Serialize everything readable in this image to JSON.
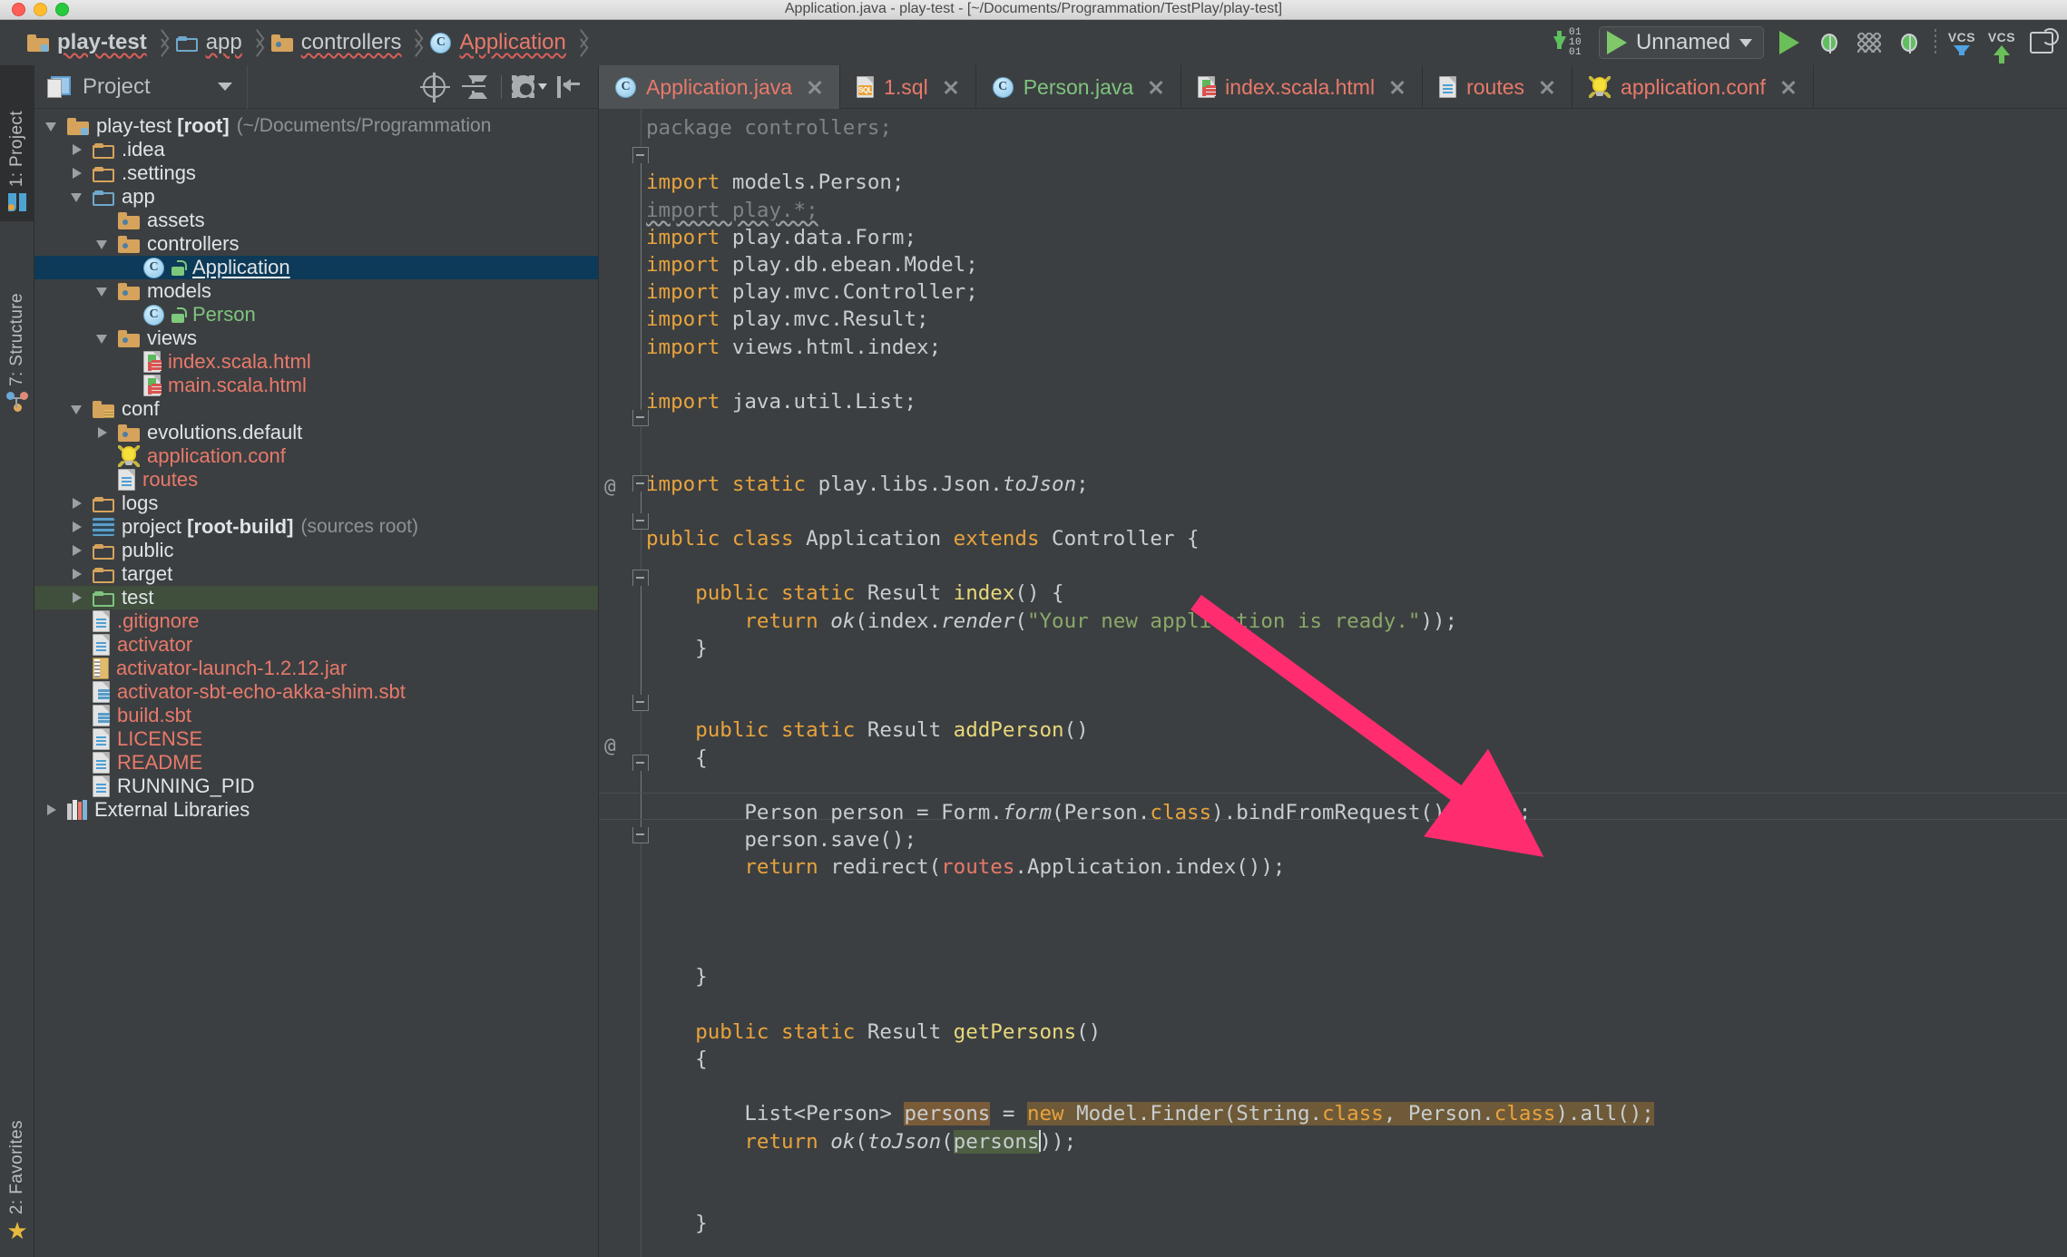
{
  "window": {
    "title": "Application.java - play-test - [~/Documents/Programmation/TestPlay/play-test]",
    "traffic_lights": [
      "close",
      "minimize",
      "zoom"
    ]
  },
  "breadcrumb": {
    "items": [
      {
        "label": "play-test",
        "icon": "folder-module-icon",
        "style": "bold-white"
      },
      {
        "label": "app",
        "icon": "folder-source-blue-icon",
        "style": "white"
      },
      {
        "label": "controllers",
        "icon": "folder-package-icon",
        "style": "white"
      },
      {
        "label": "Application",
        "icon": "java-class-icon",
        "style": "red"
      }
    ]
  },
  "toolbar": {
    "step_over_label": "01 10 01",
    "run_config_name": "Unnamed",
    "buttons": [
      {
        "name": "update-project-icon",
        "label": ""
      },
      {
        "name": "run-configurations-selector",
        "label": "Unnamed"
      },
      {
        "name": "run-button",
        "label": ""
      },
      {
        "name": "debug-button",
        "label": ""
      },
      {
        "name": "run-with-coverage-button",
        "label": ""
      },
      {
        "name": "stop-debug-button",
        "label": ""
      },
      {
        "name": "vcs-update-button",
        "label": "VCS"
      },
      {
        "name": "vcs-commit-button",
        "label": "VCS"
      },
      {
        "name": "sync-button",
        "label": ""
      }
    ]
  },
  "tool_windows": {
    "left": [
      {
        "label": "1: Project",
        "icon": "intellij-logo-icon",
        "active": true
      },
      {
        "label": "7: Structure",
        "icon": "structure-icon",
        "active": false
      }
    ],
    "bottom_left": [
      {
        "label": "2: Favorites",
        "icon": "star-icon",
        "active": false
      }
    ]
  },
  "project_panel": {
    "title": "Project",
    "actions": [
      {
        "name": "scroll-from-source-icon"
      },
      {
        "name": "collapse-all-icon"
      },
      {
        "name": "settings-gear-icon"
      },
      {
        "name": "hide-panel-icon"
      }
    ],
    "tree": [
      {
        "indent": 0,
        "arrow": "open",
        "icon": "folder-module-icon",
        "label": "play-test ",
        "bold": "[root]",
        "suffix": " (~/Documents/Programmation",
        "color": "white"
      },
      {
        "indent": 1,
        "arrow": "closed",
        "icon": "folder-icon",
        "label": ".idea",
        "color": "white"
      },
      {
        "indent": 1,
        "arrow": "closed",
        "icon": "folder-icon",
        "label": ".settings",
        "color": "white"
      },
      {
        "indent": 1,
        "arrow": "open",
        "icon": "folder-source-blue-icon",
        "label": "app",
        "color": "white"
      },
      {
        "indent": 2,
        "arrow": "none",
        "icon": "folder-package-icon",
        "label": "assets",
        "color": "white"
      },
      {
        "indent": 2,
        "arrow": "open",
        "icon": "folder-package-icon",
        "label": "controllers",
        "color": "white"
      },
      {
        "indent": 3,
        "arrow": "none",
        "icon": "java-class-icon",
        "label": "Application",
        "color": "white",
        "selected": true,
        "lock": true
      },
      {
        "indent": 2,
        "arrow": "open",
        "icon": "folder-package-icon",
        "label": "models",
        "color": "white"
      },
      {
        "indent": 3,
        "arrow": "none",
        "icon": "java-class-icon",
        "label": "Person",
        "color": "green",
        "lock": true
      },
      {
        "indent": 2,
        "arrow": "open",
        "icon": "folder-package-icon",
        "label": "views",
        "color": "white"
      },
      {
        "indent": 3,
        "arrow": "none",
        "icon": "scala-html-file-icon",
        "label": "index.scala.html",
        "color": "red"
      },
      {
        "indent": 3,
        "arrow": "none",
        "icon": "scala-html-file-icon",
        "label": "main.scala.html",
        "color": "red"
      },
      {
        "indent": 1,
        "arrow": "open",
        "icon": "folder-resources-icon",
        "label": "conf",
        "color": "white"
      },
      {
        "indent": 2,
        "arrow": "closed",
        "icon": "folder-package-icon",
        "label": "evolutions.default",
        "color": "white"
      },
      {
        "indent": 2,
        "arrow": "none",
        "icon": "conf-bulb-icon",
        "label": "application.conf",
        "color": "red"
      },
      {
        "indent": 2,
        "arrow": "none",
        "icon": "text-file-icon",
        "label": "routes",
        "color": "red"
      },
      {
        "indent": 1,
        "arrow": "closed",
        "icon": "folder-icon",
        "label": "logs",
        "color": "white"
      },
      {
        "indent": 1,
        "arrow": "closed",
        "icon": "sbt-stack-icon",
        "label": "project ",
        "bold": "[root-build]",
        "suffix": " (sources root)",
        "color": "white"
      },
      {
        "indent": 1,
        "arrow": "closed",
        "icon": "folder-icon",
        "label": "public",
        "color": "white"
      },
      {
        "indent": 1,
        "arrow": "closed",
        "icon": "folder-icon",
        "label": "target",
        "color": "white"
      },
      {
        "indent": 1,
        "arrow": "closed",
        "icon": "folder-test-green-icon",
        "label": "test",
        "color": "white",
        "greenhl": true
      },
      {
        "indent": 1,
        "arrow": "none",
        "icon": "text-file-icon",
        "label": ".gitignore",
        "color": "red"
      },
      {
        "indent": 1,
        "arrow": "none",
        "icon": "text-file-icon",
        "label": "activator",
        "color": "red"
      },
      {
        "indent": 1,
        "arrow": "none",
        "icon": "jar-file-icon",
        "label": "activator-launch-1.2.12.jar",
        "color": "red"
      },
      {
        "indent": 1,
        "arrow": "none",
        "icon": "sbt-file-icon",
        "label": "activator-sbt-echo-akka-shim.sbt",
        "color": "red"
      },
      {
        "indent": 1,
        "arrow": "none",
        "icon": "sbt-file-icon",
        "label": "build.sbt",
        "color": "red"
      },
      {
        "indent": 1,
        "arrow": "none",
        "icon": "text-file-icon",
        "label": "LICENSE",
        "color": "red"
      },
      {
        "indent": 1,
        "arrow": "none",
        "icon": "text-file-icon",
        "label": "README",
        "color": "red"
      },
      {
        "indent": 1,
        "arrow": "none",
        "icon": "text-file-icon",
        "label": "RUNNING_PID",
        "color": "white"
      },
      {
        "indent": 0,
        "arrow": "closed",
        "icon": "external-libraries-icon",
        "label": "External Libraries",
        "color": "white"
      }
    ]
  },
  "editor": {
    "tabs": [
      {
        "label": "Application.java",
        "icon": "java-class-icon",
        "color": "red",
        "active": true
      },
      {
        "label": "1.sql",
        "icon": "sql-file-icon",
        "color": "red",
        "active": false
      },
      {
        "label": "Person.java",
        "icon": "java-class-icon",
        "color": "green",
        "active": false
      },
      {
        "label": "index.scala.html",
        "icon": "scala-html-file-icon",
        "color": "red",
        "active": false
      },
      {
        "label": "routes",
        "icon": "text-file-icon",
        "color": "red",
        "active": false
      },
      {
        "label": "application.conf",
        "icon": "conf-bulb-icon",
        "color": "red",
        "active": false
      }
    ],
    "filename": "Application.java",
    "code_lines": [
      "package controllers;",
      "",
      "import models.Person;",
      "import play.*;",
      "import play.data.Form;",
      "import play.db.ebean.Model;",
      "import play.mvc.Controller;",
      "import play.mvc.Result;",
      "import views.html.index;",
      "",
      "import java.util.List;",
      "",
      "",
      "import static play.libs.Json.toJson;",
      "",
      "public class Application extends Controller {",
      "",
      "    public static Result index() {",
      "        return ok(index.render(\"Your new application is ready.\"));",
      "    }",
      "",
      "",
      "    public static Result addPerson()",
      "    {",
      "",
      "        Person person = Form.form(Person.class).bindFromRequest().get();",
      "        person.save();",
      "        return redirect(routes.Application.index());",
      "",
      "",
      "",
      "    }",
      "",
      "    public static Result getPersons()",
      "    {",
      "",
      "        List<Person> persons = new Model.Finder(String.class, Person.class).all();",
      "        return ok(toJson(persons));",
      "",
      "",
      "    }",
      "",
      "}"
    ],
    "selection_text": "new Model.Finder(String.class, Person.class).all();",
    "caret_word": "persons",
    "annotation_markers": [
      "@",
      "@"
    ]
  },
  "annotation": {
    "arrow_color": "#ff2d6f",
    "description": "pink arrow pointing from upper-left to the addPerson body"
  }
}
